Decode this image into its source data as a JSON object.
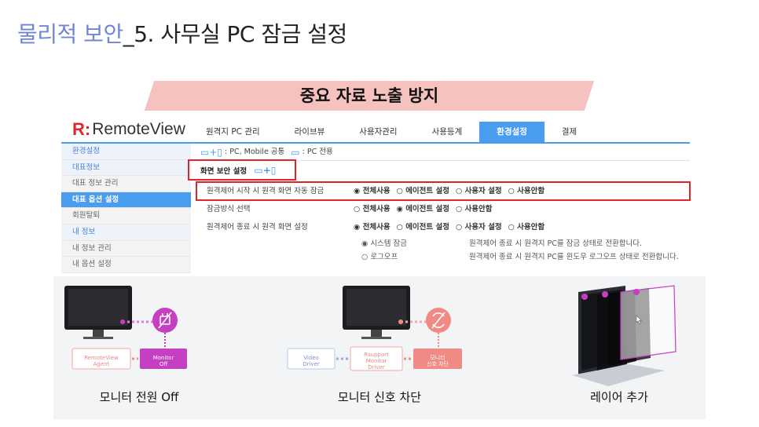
{
  "slide": {
    "title_accent": "물리적 보안",
    "title_rest": "_5. 사무실 PC 잠금 설정",
    "banner": "중요 자료 노출 방지"
  },
  "app": {
    "brand_logo": "R:",
    "brand_name": "RemoteView"
  },
  "top_nav": [
    {
      "label": "원격지 PC 관리",
      "active": false
    },
    {
      "label": "라이브뷰",
      "active": false
    },
    {
      "label": "사용자관리",
      "active": false
    },
    {
      "label": "사용등계",
      "active": false
    },
    {
      "label": "환경설정",
      "active": true
    },
    {
      "label": "결제",
      "active": false
    }
  ],
  "side_nav": [
    {
      "label": "환경설정",
      "kind": "section"
    },
    {
      "label": "대표정보",
      "kind": "section"
    },
    {
      "label": "대표 정보 관리",
      "kind": "item"
    },
    {
      "label": "대표 옵션 설정",
      "kind": "active"
    },
    {
      "label": "회원탈퇴",
      "kind": "item"
    },
    {
      "label": "내 정보",
      "kind": "section"
    },
    {
      "label": "내 정보 관리",
      "kind": "item"
    },
    {
      "label": "내 옵션 설정",
      "kind": "item"
    }
  ],
  "mode_bar": {
    "icons_both": "▭+▯",
    "both_label": ": PC, Mobile 공통",
    "icon_pc": "▭",
    "pc_label": ": PC 전용"
  },
  "section": {
    "title": "화면 보안 설정",
    "icons": "▭+▯"
  },
  "options": [
    {
      "label": "원격제어 시작 시 원격 화면 자동 잠금",
      "choices": [
        {
          "label": "전체사용",
          "selected": true
        },
        {
          "label": "에이전트 설정",
          "selected": false
        },
        {
          "label": "사용자 설정",
          "selected": false
        },
        {
          "label": "사용안함",
          "selected": false
        }
      ]
    },
    {
      "label": "잠금방식 선택",
      "choices": [
        {
          "label": "전체사용",
          "selected": false
        },
        {
          "label": "에이전트 설정",
          "selected": true
        },
        {
          "label": "사용안함",
          "selected": false
        }
      ]
    },
    {
      "label": "원격제어 종료 시 원격 화면 설정",
      "choices": [
        {
          "label": "전체사용",
          "selected": true
        },
        {
          "label": "에이전트 설정",
          "selected": false
        },
        {
          "label": "사용자 설정",
          "selected": false
        },
        {
          "label": "사용안함",
          "selected": false
        }
      ]
    }
  ],
  "sub_options": [
    {
      "label": "시스템 잠금",
      "selected": true,
      "desc": "원격제어 종료 시 원격지 PC를 잠금 상태로 전환합니다."
    },
    {
      "label": "로그오프",
      "selected": false,
      "desc": "원격제어 종료 시 원격지 PC를 윈도우 로그오프 상태로 전환합니다."
    }
  ],
  "illustrations": {
    "captions": [
      "모니터 전원 Off",
      "모니터 신호 차단",
      "레이어 추가"
    ],
    "diagram1": {
      "agent_tag": "RemoteView\nAgent",
      "monitor_tag": "Monitor\nOff"
    },
    "diagram2": {
      "video_tag": "Video\nDriver",
      "rsupport_tag": "Rsupport\nMonitor\nDriver",
      "block_tag": "모니터\n신호 차단"
    }
  },
  "colors": {
    "accent_blue": "#4a9cee",
    "highlight_red": "#e0262c",
    "banner_pink": "#f5c2c0",
    "title_accent": "#7086d4",
    "magenta": "#c63fc3",
    "salmon": "#f08a84"
  }
}
